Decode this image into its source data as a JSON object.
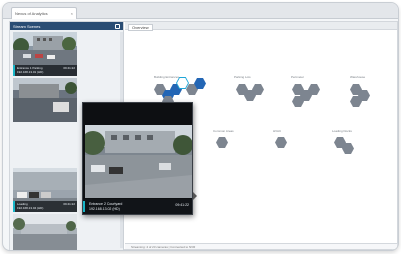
{
  "tab": {
    "label": "Nexus of Analytics",
    "close": "×"
  },
  "left": {
    "header": "Stream Scenes"
  },
  "cameras": [
    {
      "title": "Entrance 1 Parking",
      "sub": "192.168.13.01 (HD)",
      "time": "09:41:22"
    },
    {
      "title": "",
      "sub": "",
      "time": ""
    },
    {
      "title": "Loading",
      "sub": "192.168.13.04 (HD)",
      "time": "09:41:22"
    },
    {
      "title": "",
      "sub": "",
      "time": ""
    }
  ],
  "graph": {
    "header": "Overview",
    "groups": [
      "Building Entrances",
      "Parking Lots",
      "Perimeter",
      "Warehouse",
      "Common Areas",
      "HVAC",
      "Loading Docks"
    ]
  },
  "popup": {
    "title": "Entrance 2 Courtyard",
    "sub": "192.168.13.02 (HD)",
    "time": "09:41:22"
  },
  "status": {
    "text": "Streaming: 4 of 23 cameras | Connected to NVR"
  },
  "colors": {
    "accent": "#18b6c8",
    "hex_blue": "#2366b5",
    "hex_gray": "#7d8590",
    "header": "#2a4d74"
  }
}
